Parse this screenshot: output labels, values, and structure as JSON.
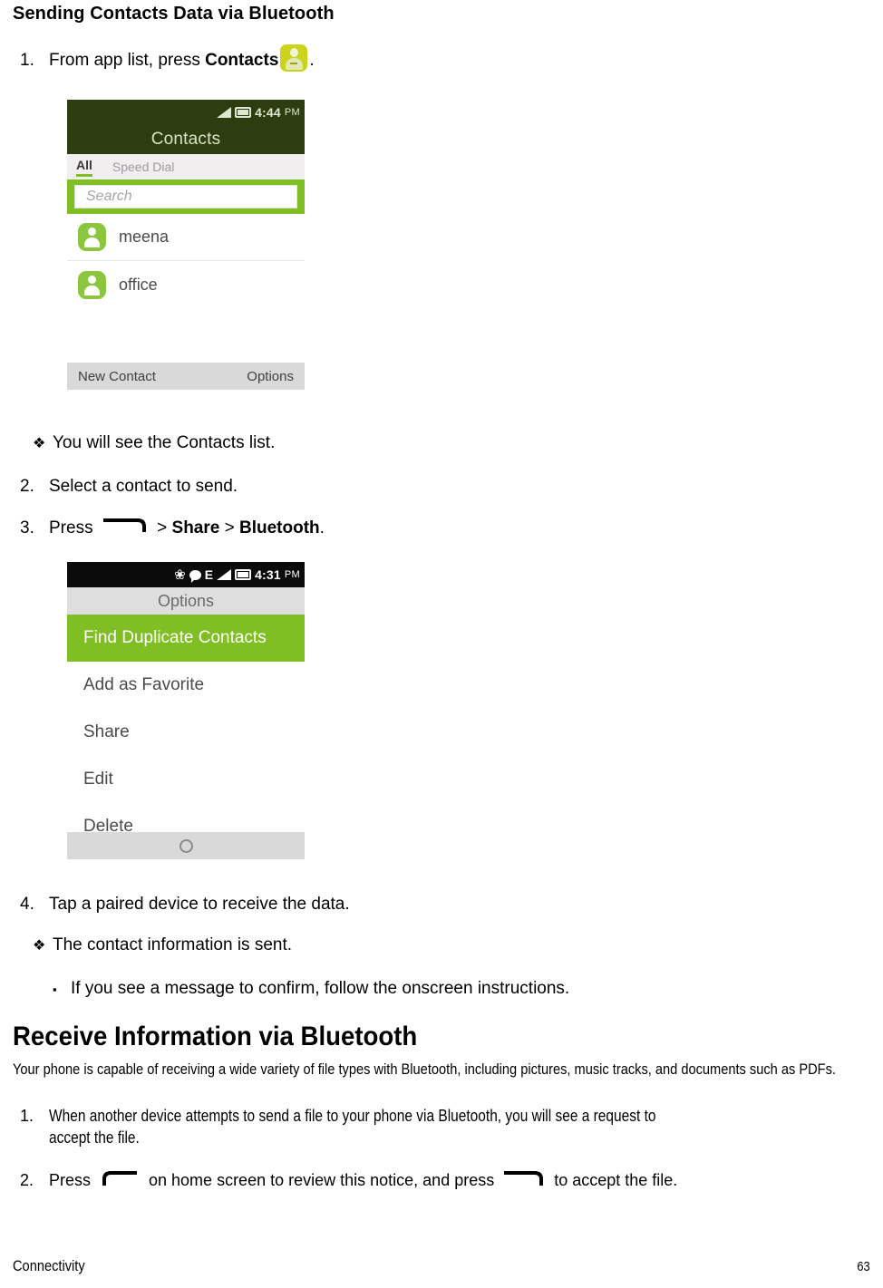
{
  "document": {
    "heading_1": "Sending Contacts Data via Bluetooth",
    "heading_2": "Receive Information via Bluetooth",
    "intro_paragraph": "Your phone is capable of receiving a wide variety of file types with Bluetooth, including pictures, music tracks, and documents such as PDFs."
  },
  "send_steps": {
    "step1": {
      "number": "1.",
      "text_before": "From app list, press ",
      "bold": "Contacts",
      "icon": "contacts-app-icon",
      "text_after": "."
    },
    "note1": {
      "bullet": "❖",
      "text": "You will see the Contacts list."
    },
    "step2": {
      "number": "2.",
      "text": "Select a contact to send."
    },
    "step3": {
      "number": "3.",
      "text_before": "Press ",
      "softkey": "right-softkey-icon",
      "separator1": " > ",
      "bold1": "Share",
      "separator2": " > ",
      "bold2": "Bluetooth",
      "text_after": "."
    },
    "step4": {
      "number": "4.",
      "text": "Tap a paired device to receive the data."
    },
    "note2": {
      "bullet": "❖",
      "text": "The contact information is sent."
    },
    "note3": {
      "bullet": "▪",
      "text": "If you see a message to confirm, follow the onscreen instructions."
    }
  },
  "receive_steps": {
    "step1": {
      "number": "1.",
      "line1": "When another device attempts to send a file to your phone via Bluetooth, you will see a request to",
      "line2": "accept the file."
    },
    "step2": {
      "number": "2.",
      "text_before": "Press ",
      "softkey_left": "left-softkey-icon",
      "text_middle": " on home screen to review this notice, and press ",
      "softkey_right": "right-softkey-icon",
      "text_after": " to accept the file."
    }
  },
  "screenshot_contacts": {
    "status_bar": {
      "signal_icon": "signal-bars-icon",
      "battery_icon": "battery-icon",
      "time": "4:44",
      "ampm": "PM"
    },
    "app_title": "Contacts",
    "tabs": [
      {
        "label": "All",
        "active": true
      },
      {
        "label": "Speed Dial",
        "active": false
      }
    ],
    "search_placeholder": "Search",
    "contacts": [
      {
        "name": "meena",
        "avatar": "person-avatar-icon"
      },
      {
        "name": "office",
        "avatar": "person-avatar-icon"
      }
    ],
    "bottom_bar": {
      "left": "New Contact",
      "right": "Options"
    },
    "colors": {
      "status_bar": "#2e3d10",
      "app_bar": "#2e3d10",
      "accent_green": "#7fbf23",
      "tab_bar": "#f1eef0",
      "bottom_bar": "#d9d9d9",
      "avatar_green": "#8cc63f"
    }
  },
  "screenshot_options": {
    "status_bar": {
      "bluetooth_icon": "bluetooth-icon",
      "message_icon": "message-bubble-icon",
      "network_label": "E",
      "signal_icon": "signal-bars-icon",
      "battery_icon": "battery-icon",
      "time": "4:31",
      "ampm": "PM"
    },
    "title": "Options",
    "menu_items": [
      {
        "label": "Find Duplicate Contacts",
        "selected": true
      },
      {
        "label": "Add as Favorite",
        "selected": false
      },
      {
        "label": "Share",
        "selected": false
      },
      {
        "label": "Edit",
        "selected": false
      },
      {
        "label": "Delete",
        "selected": false
      }
    ],
    "bottom_bar_icon": "home-circle-key-icon",
    "colors": {
      "status_bar": "#0b0b0b",
      "title_bar": "#dedede",
      "selected_row": "#7fbf23",
      "bottom_bar": "#d9d9d9"
    }
  },
  "footer": {
    "section": "Connectivity",
    "page_number": "63"
  }
}
